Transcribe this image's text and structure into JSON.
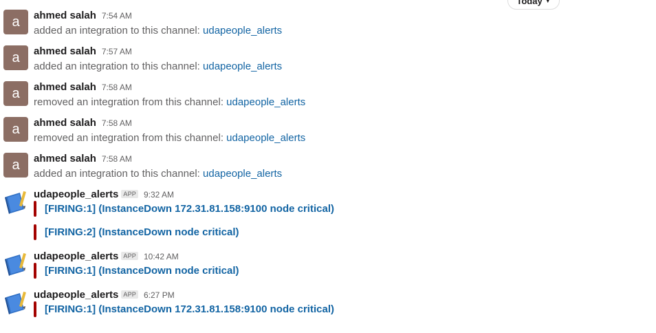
{
  "date_divider": {
    "label": "Today",
    "chevron": "chevron-down-icon"
  },
  "avatar_color": "#8c6e64",
  "alert_bar_color": "#a30200",
  "link_color": "#1264a3",
  "messages": [
    {
      "author": "ahmed salah",
      "avatar_letter": "a",
      "time": "7:54 AM",
      "text": "added an integration to this channel: ",
      "link": "udapeople_alerts"
    },
    {
      "author": "ahmed salah",
      "avatar_letter": "a",
      "time": "7:57 AM",
      "text": "added an integration to this channel: ",
      "link": "udapeople_alerts"
    },
    {
      "author": "ahmed salah",
      "avatar_letter": "a",
      "time": "7:58 AM",
      "text": "removed an integration from this channel: ",
      "link": "udapeople_alerts"
    },
    {
      "author": "ahmed salah",
      "avatar_letter": "a",
      "time": "7:58 AM",
      "text": "removed an integration from this channel: ",
      "link": "udapeople_alerts"
    },
    {
      "author": "ahmed salah",
      "avatar_letter": "a",
      "time": "7:58 AM",
      "text": "added an integration to this channel: ",
      "link": "udapeople_alerts"
    }
  ],
  "app_messages": [
    {
      "author": "udapeople_alerts",
      "badge": "APP",
      "time": "9:32 AM",
      "avatar_icon": "blue-book-icon",
      "attachments": [
        "[FIRING:1]  (InstanceDown 172.31.81.158:9100 node critical)",
        "[FIRING:2]  (InstanceDown node critical)"
      ]
    },
    {
      "author": "udapeople_alerts",
      "badge": "APP",
      "time": "10:42 AM",
      "avatar_icon": "blue-book-icon",
      "attachments": [
        "[FIRING:1]  (InstanceDown node critical)"
      ]
    },
    {
      "author": "udapeople_alerts",
      "badge": "APP",
      "time": "6:27 PM",
      "avatar_icon": "blue-book-icon",
      "attachments": [
        "[FIRING:1]  (InstanceDown 172.31.81.158:9100 node critical)"
      ]
    }
  ]
}
